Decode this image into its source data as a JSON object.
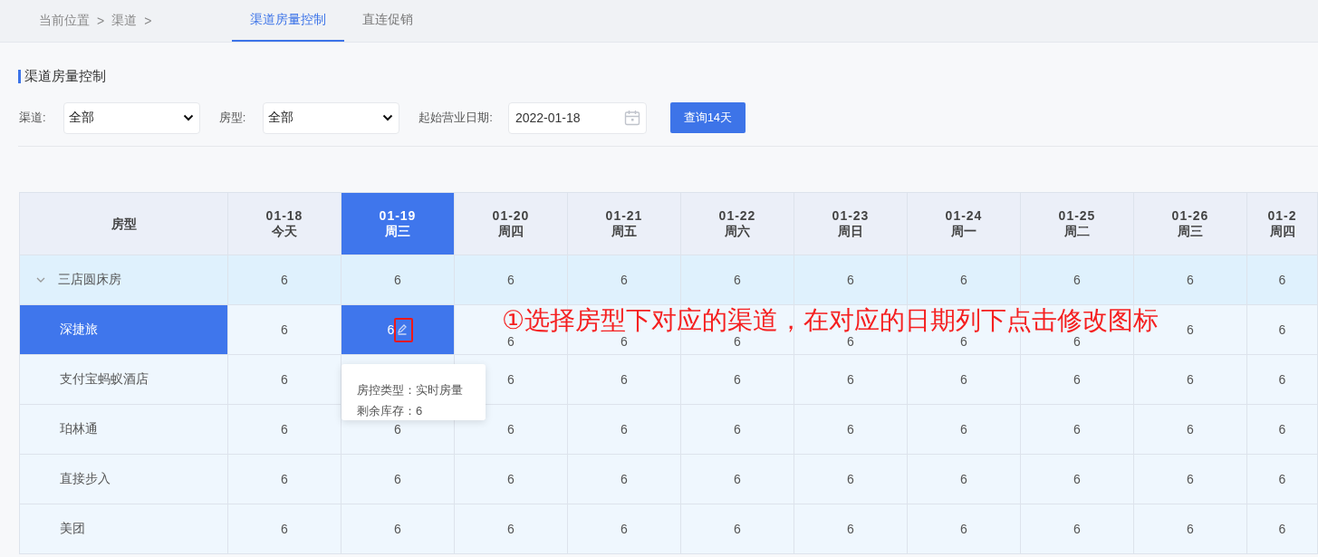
{
  "breadcrumb": [
    "当前位置",
    ">",
    "渠道",
    ">"
  ],
  "tabs": [
    {
      "label": "渠道房量控制",
      "selected": true
    },
    {
      "label": "直连促销",
      "selected": false
    }
  ],
  "section_title": "渠道房量控制",
  "filters": [
    {
      "kind": "select",
      "label": "渠道:",
      "value": "全部"
    },
    {
      "kind": "select",
      "label": "房型:",
      "value": "全部"
    },
    {
      "kind": "date",
      "label": "起始营业日期:",
      "value": "2022-01-18"
    }
  ],
  "query_button": "查询14天",
  "table": {
    "first_column": "房型",
    "columns": [
      {
        "date": "01-18",
        "day": "今天",
        "selected": false
      },
      {
        "date": "01-19",
        "day": "周三",
        "selected": true
      },
      {
        "date": "01-20",
        "day": "周四",
        "selected": false
      },
      {
        "date": "01-21",
        "day": "周五",
        "selected": false
      },
      {
        "date": "01-22",
        "day": "周六",
        "selected": false
      },
      {
        "date": "01-23",
        "day": "周日",
        "selected": false
      },
      {
        "date": "01-24",
        "day": "周一",
        "selected": false
      },
      {
        "date": "01-25",
        "day": "周二",
        "selected": false
      },
      {
        "date": "01-26",
        "day": "周三",
        "selected": false
      },
      {
        "date": "01-2",
        "day": "周四",
        "selected": false
      }
    ],
    "groups": [
      {
        "name": "三店圆床房",
        "expanded": true,
        "values": [
          "6",
          "6",
          "6",
          "6",
          "6",
          "6",
          "6",
          "6",
          "6",
          "6"
        ],
        "children": [
          {
            "name": "深捷旅",
            "selected": true,
            "values": [
              "6",
              "6",
              "6",
              "6",
              "6",
              "6",
              "6",
              "6",
              "6",
              "6"
            ]
          },
          {
            "name": "支付宝蚂蚁酒店",
            "selected": false,
            "values": [
              "6",
              {
                "covered": true
              },
              "6",
              "6",
              "6",
              "6",
              "6",
              "6",
              "6",
              "6"
            ]
          },
          {
            "name": "珀林通",
            "selected": false,
            "values": [
              "6",
              "6",
              "6",
              "6",
              "6",
              "6",
              "6",
              "6",
              "6",
              "6"
            ]
          },
          {
            "name": "直接步入",
            "selected": false,
            "values": [
              "6",
              "6",
              "6",
              "6",
              "6",
              "6",
              "6",
              "6",
              "6",
              "6"
            ]
          },
          {
            "name": "美团",
            "selected": false,
            "values": [
              "6",
              "6",
              "6",
              "6",
              "6",
              "6",
              "6",
              "6",
              "6",
              "6"
            ]
          }
        ]
      }
    ]
  },
  "tooltip": [
    "房控类型：实时房量",
    "剩余库存：6"
  ],
  "annotation": "①选择房型下对应的渠道，在对应的日期列下点击修改图标"
}
